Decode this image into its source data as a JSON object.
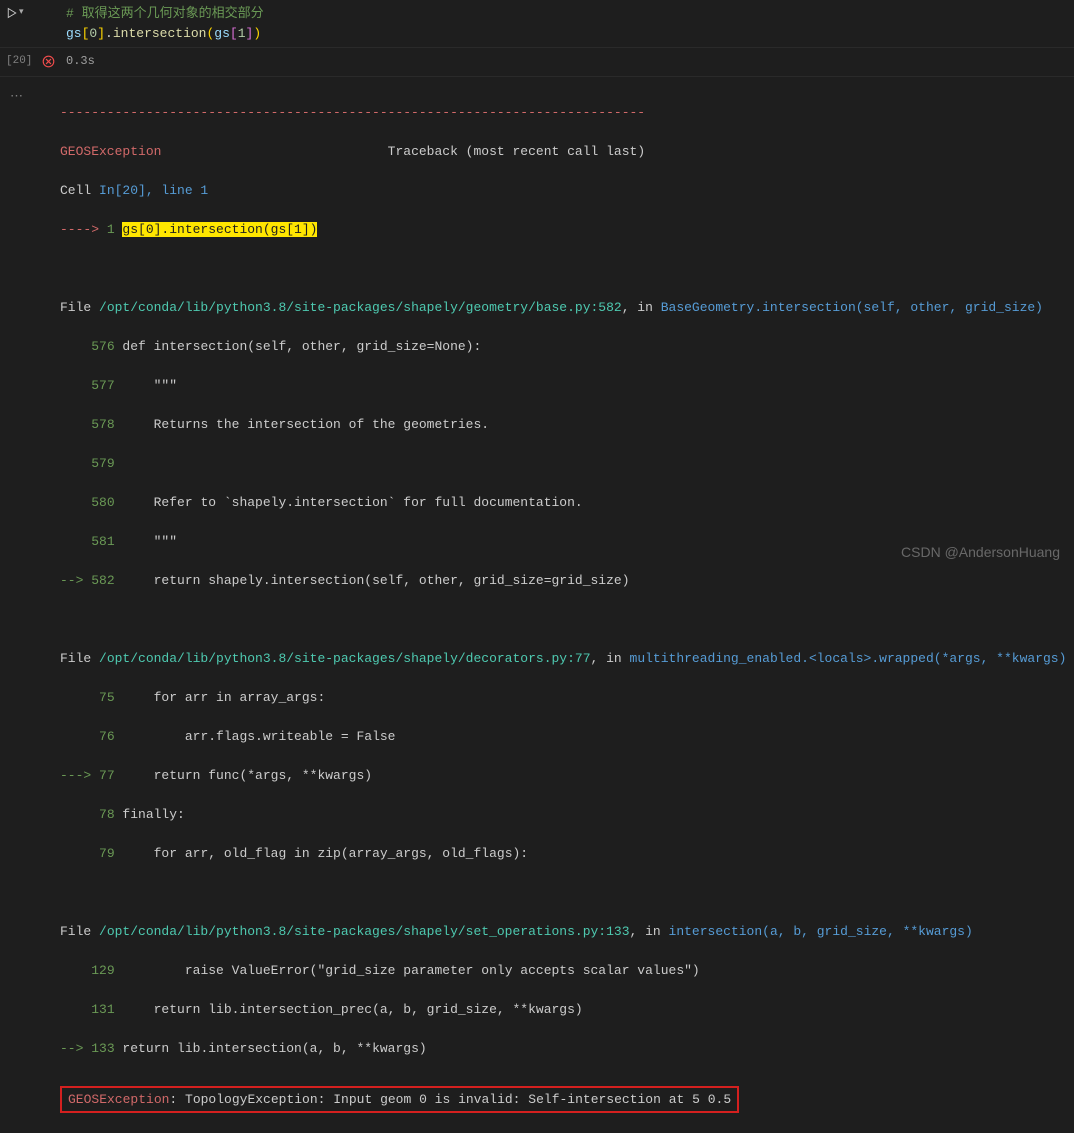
{
  "input": {
    "comment": "# 取得这两个几何对象的相交部分",
    "code_parts": {
      "gs": "gs",
      "idx0": "0",
      "method": "intersection",
      "idx1": "1"
    }
  },
  "exec": {
    "label": "[20]",
    "time": "0.3s"
  },
  "traceback": {
    "divider": "---------------------------------------------------------------------------",
    "exception_name": "GEOSException",
    "header_tail": "Traceback (most recent call last)",
    "cell_ref": "Cell ",
    "cell_in": "In[20], line 1",
    "arrow1": "----> ",
    "arrow1_num": "1 ",
    "hl_code": "gs[0].intersection(gs[1])",
    "file_label": "File ",
    "frame1": {
      "path": "/opt/conda/lib/python3.8/site-packages/shapely/geometry/base.py:582",
      "in": ", in ",
      "func": "BaseGeometry.intersection(self, other, grid_size)",
      "l576n": "576",
      "l576": " def intersection(self, other, grid_size=None):",
      "l577n": "577",
      "l577": "     \"\"\"",
      "l578n": "578",
      "l578": "     Returns the intersection of the geometries.",
      "l579n": "579",
      "l579": "",
      "l580n": "580",
      "l580": "     Refer to `shapely.intersection` for full documentation.",
      "l581n": "581",
      "l581": "     \"\"\"",
      "arrow": "--> ",
      "l582n": "582",
      "l582": "     return shapely.intersection(self, other, grid_size=grid_size)"
    },
    "frame2": {
      "path": "/opt/conda/lib/python3.8/site-packages/shapely/decorators.py:77",
      "in": ", in ",
      "func": "multithreading_enabled.<locals>.wrapped(*args, **kwargs)",
      "l75n": "75",
      "l75": "     for arr in array_args:",
      "l76n": "76",
      "l76": "         arr.flags.writeable = False",
      "arrow": "---> ",
      "l77n": "77",
      "l77": "     return func(*args, **kwargs)",
      "l78n": "78",
      "l78": " finally:",
      "l79n": "79",
      "l79": "     for arr, old_flag in zip(array_args, old_flags):"
    },
    "frame3": {
      "path": "/opt/conda/lib/python3.8/site-packages/shapely/set_operations.py:133",
      "in": ", in ",
      "func": "intersection(a, b, grid_size, **kwargs)",
      "l129n": "129",
      "l129": "         raise ValueError(\"grid_size parameter only accepts scalar values\")",
      "l131n": "131",
      "l131": "     return lib.intersection_prec(a, b, grid_size, **kwargs)",
      "arrow": "--> ",
      "l133n": "133",
      "l133": " return lib.intersection(a, b, **kwargs)"
    },
    "final": {
      "name": "GEOSException",
      "sep": ": ",
      "msg": "TopologyException: Input geom 0 is invalid: Self-intersection at 5 0.5"
    }
  },
  "watermark": "CSDN @AndersonHuang"
}
